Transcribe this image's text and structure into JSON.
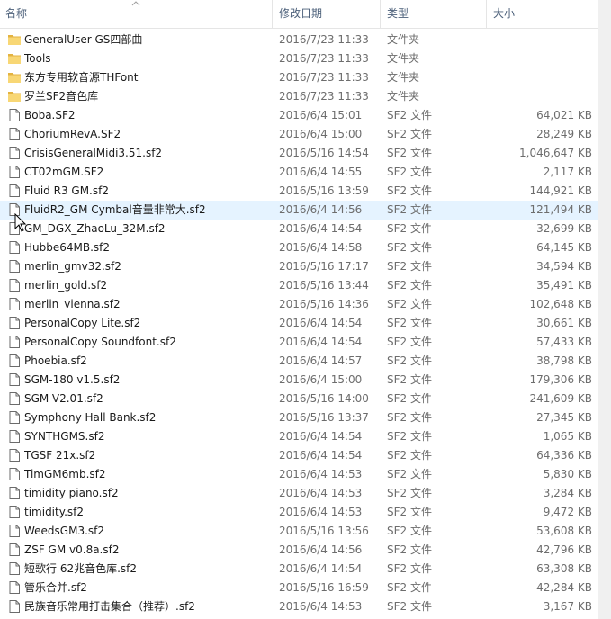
{
  "columns": {
    "name": "名称",
    "date": "修改日期",
    "type": "类型",
    "size": "大小"
  },
  "colors": {
    "folder": "#f8d775",
    "folder_dark": "#e3b341",
    "hover": "#e5f3ff",
    "header_text": "#4c607a"
  },
  "icons": {
    "folder": "folder-icon",
    "file": "file-icon",
    "sort": "sort-ascending-icon",
    "cursor": "mouse-cursor-icon"
  },
  "files": [
    {
      "name": "GeneralUser GS四部曲",
      "date": "2016/7/23 11:33",
      "type": "文件夹",
      "size": "",
      "kind": "folder"
    },
    {
      "name": "Tools",
      "date": "2016/7/23 11:33",
      "type": "文件夹",
      "size": "",
      "kind": "folder"
    },
    {
      "name": "东方专用软音源THFont",
      "date": "2016/7/23 11:33",
      "type": "文件夹",
      "size": "",
      "kind": "folder"
    },
    {
      "name": "罗兰SF2音色库",
      "date": "2016/7/23 11:33",
      "type": "文件夹",
      "size": "",
      "kind": "folder"
    },
    {
      "name": "Boba.SF2",
      "date": "2016/6/4 15:01",
      "type": "SF2 文件",
      "size": "64,021 KB",
      "kind": "file"
    },
    {
      "name": "ChoriumRevA.SF2",
      "date": "2016/6/4 15:00",
      "type": "SF2 文件",
      "size": "28,249 KB",
      "kind": "file"
    },
    {
      "name": "CrisisGeneralMidi3.51.sf2",
      "date": "2016/5/16 14:54",
      "type": "SF2 文件",
      "size": "1,046,647 KB",
      "kind": "file"
    },
    {
      "name": "CT02mGM.SF2",
      "date": "2016/6/4 14:55",
      "type": "SF2 文件",
      "size": "2,117 KB",
      "kind": "file"
    },
    {
      "name": "Fluid R3 GM.sf2",
      "date": "2016/5/16 13:59",
      "type": "SF2 文件",
      "size": "144,921 KB",
      "kind": "file"
    },
    {
      "name": "FluidR2_GM Cymbal音量非常大.sf2",
      "date": "2016/6/4 14:56",
      "type": "SF2 文件",
      "size": "121,494 KB",
      "kind": "file",
      "hover": true
    },
    {
      "name": "GM_DGX_ZhaoLu_32M.sf2",
      "date": "2016/6/4 14:54",
      "type": "SF2 文件",
      "size": "32,699 KB",
      "kind": "file"
    },
    {
      "name": "Hubbe64MB.sf2",
      "date": "2016/6/4 14:58",
      "type": "SF2 文件",
      "size": "64,145 KB",
      "kind": "file"
    },
    {
      "name": "merlin_gmv32.sf2",
      "date": "2016/5/16 17:17",
      "type": "SF2 文件",
      "size": "34,594 KB",
      "kind": "file"
    },
    {
      "name": "merlin_gold.sf2",
      "date": "2016/5/16 13:44",
      "type": "SF2 文件",
      "size": "35,491 KB",
      "kind": "file"
    },
    {
      "name": "merlin_vienna.sf2",
      "date": "2016/5/16 14:36",
      "type": "SF2 文件",
      "size": "102,648 KB",
      "kind": "file"
    },
    {
      "name": "PersonalCopy Lite.sf2",
      "date": "2016/6/4 14:54",
      "type": "SF2 文件",
      "size": "30,661 KB",
      "kind": "file"
    },
    {
      "name": "PersonalCopy Soundfont.sf2",
      "date": "2016/6/4 14:54",
      "type": "SF2 文件",
      "size": "57,433 KB",
      "kind": "file"
    },
    {
      "name": "Phoebia.sf2",
      "date": "2016/6/4 14:57",
      "type": "SF2 文件",
      "size": "38,798 KB",
      "kind": "file"
    },
    {
      "name": "SGM-180 v1.5.sf2",
      "date": "2016/6/4 15:00",
      "type": "SF2 文件",
      "size": "179,306 KB",
      "kind": "file"
    },
    {
      "name": "SGM-V2.01.sf2",
      "date": "2016/5/16 14:00",
      "type": "SF2 文件",
      "size": "241,609 KB",
      "kind": "file"
    },
    {
      "name": "Symphony Hall Bank.sf2",
      "date": "2016/5/16 13:37",
      "type": "SF2 文件",
      "size": "27,345 KB",
      "kind": "file"
    },
    {
      "name": "SYNTHGMS.sf2",
      "date": "2016/6/4 14:54",
      "type": "SF2 文件",
      "size": "1,065 KB",
      "kind": "file"
    },
    {
      "name": "TGSF 21x.sf2",
      "date": "2016/6/4 14:54",
      "type": "SF2 文件",
      "size": "64,336 KB",
      "kind": "file"
    },
    {
      "name": "TimGM6mb.sf2",
      "date": "2016/6/4 14:53",
      "type": "SF2 文件",
      "size": "5,830 KB",
      "kind": "file"
    },
    {
      "name": "timidity piano.sf2",
      "date": "2016/6/4 14:53",
      "type": "SF2 文件",
      "size": "3,284 KB",
      "kind": "file"
    },
    {
      "name": "timidity.sf2",
      "date": "2016/6/4 14:53",
      "type": "SF2 文件",
      "size": "9,472 KB",
      "kind": "file"
    },
    {
      "name": "WeedsGM3.sf2",
      "date": "2016/5/16 13:56",
      "type": "SF2 文件",
      "size": "53,608 KB",
      "kind": "file"
    },
    {
      "name": "ZSF GM v0.8a.sf2",
      "date": "2016/6/4 14:56",
      "type": "SF2 文件",
      "size": "42,796 KB",
      "kind": "file"
    },
    {
      "name": "短歌行 62兆音色库.sf2",
      "date": "2016/6/4 14:54",
      "type": "SF2 文件",
      "size": "63,308 KB",
      "kind": "file"
    },
    {
      "name": "管乐合并.sf2",
      "date": "2016/5/16 16:59",
      "type": "SF2 文件",
      "size": "42,284 KB",
      "kind": "file"
    },
    {
      "name": "民族音乐常用打击集合（推荐）.sf2",
      "date": "2016/6/4 14:53",
      "type": "SF2 文件",
      "size": "3,167 KB",
      "kind": "file"
    }
  ]
}
